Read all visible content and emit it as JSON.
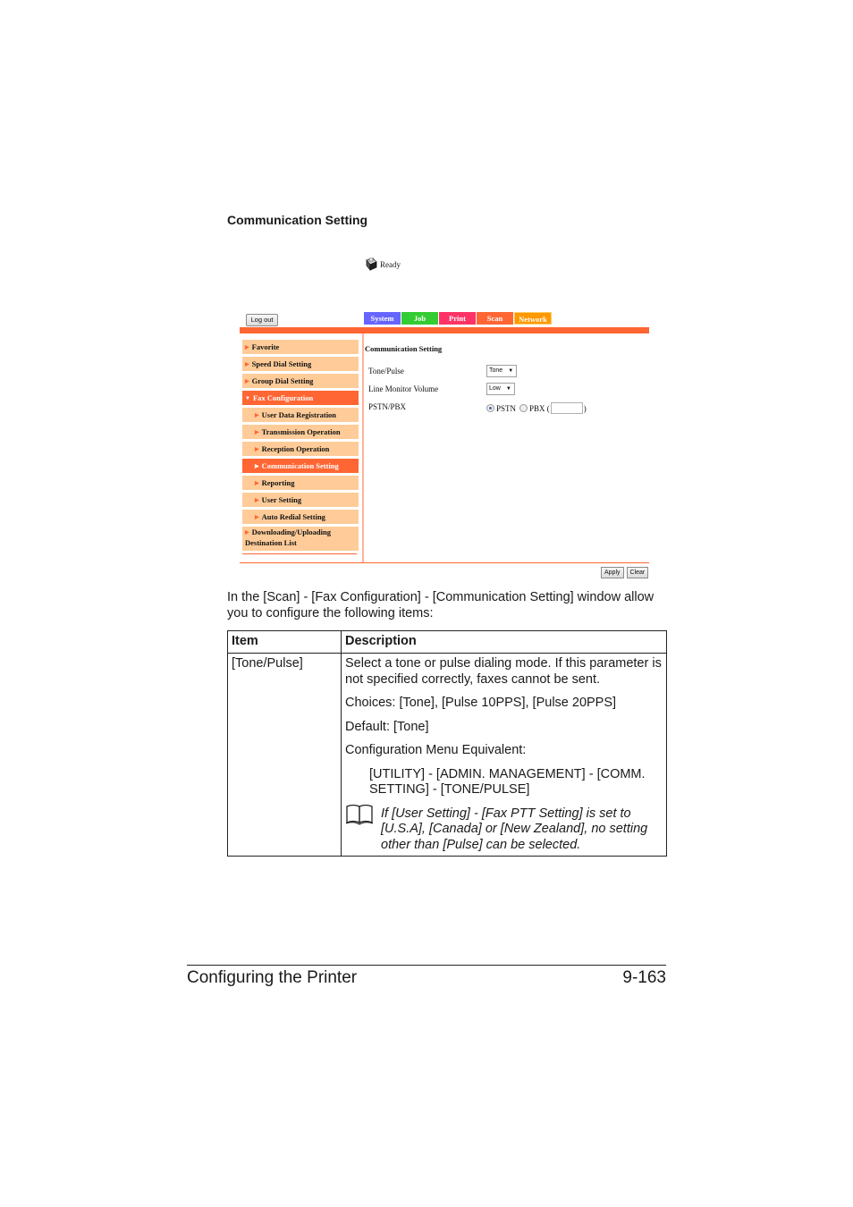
{
  "section_heading": "Communication Setting",
  "webui": {
    "status": {
      "icon": "printer-icon",
      "text": "Ready"
    },
    "logout_label": "Log out",
    "tabs": [
      {
        "label": "System",
        "color": "#6666ff"
      },
      {
        "label": "Job",
        "color": "#33cc33"
      },
      {
        "label": "Print",
        "color": "#ff3366"
      },
      {
        "label": "Scan",
        "color": "#ff6633",
        "active": true
      },
      {
        "label": "Network",
        "color": "#ff9900"
      }
    ],
    "sidebar": {
      "items": [
        {
          "label": "Favorite"
        },
        {
          "label": "Speed Dial Setting"
        },
        {
          "label": "Group Dial Setting"
        },
        {
          "label": "Fax Configuration",
          "expanded": true,
          "active": true
        },
        {
          "label": "User Data Registration",
          "sub": true
        },
        {
          "label": "Transmission Operation",
          "sub": true
        },
        {
          "label": "Reception Operation",
          "sub": true
        },
        {
          "label": "Communication Setting",
          "sub": true,
          "active": true
        },
        {
          "label": "Reporting",
          "sub": true
        },
        {
          "label": "User Setting",
          "sub": true
        },
        {
          "label": "Auto Redial Setting",
          "sub": true
        },
        {
          "label_line1": "Downloading/Uploading",
          "label_line2": "Destination List"
        }
      ]
    },
    "content": {
      "title": "Communication Setting",
      "fields": {
        "tone_pulse": {
          "label": "Tone/Pulse",
          "value": "Tone"
        },
        "line_monitor_volume": {
          "label": "Line Monitor Volume",
          "value": "Low"
        },
        "pstn_pbx": {
          "label": "PSTN/PBX",
          "options": [
            {
              "label": "PSTN",
              "checked": true
            },
            {
              "label": "PBX (",
              "checked": false
            }
          ],
          "pbx_value": "",
          "close_paren": ")"
        }
      }
    },
    "buttons": {
      "apply": "Apply",
      "clear": "Clear"
    },
    "colors": {
      "accent": "#ff6633",
      "nav_bg": "#ffcc99"
    }
  },
  "intro": "In the [Scan] - [Fax Configuration] - [Communication Setting] window allow you to configure the following items:",
  "table": {
    "headers": [
      "Item",
      "Description"
    ],
    "rows": [
      {
        "item": "[Tone/Pulse]",
        "description": [
          "Select a tone or pulse dialing mode. If this parameter is not specified correctly, faxes cannot be sent.",
          "Choices: [Tone], [Pulse 10PPS], [Pulse 20PPS]",
          "Default: [Tone]",
          "Configuration Menu Equivalent:"
        ],
        "menu_path": "[UTILITY] - [ADMIN. MANAGEMENT] - [COMM. SETTING] - [TONE/PULSE]",
        "note": "If [User Setting] - [Fax PTT Setting] is set to [U.S.A], [Canada] or [New Zealand], no setting other than [Pulse] can be selected."
      }
    ]
  },
  "footer": {
    "title": "Configuring the Printer",
    "page": "9-163"
  }
}
